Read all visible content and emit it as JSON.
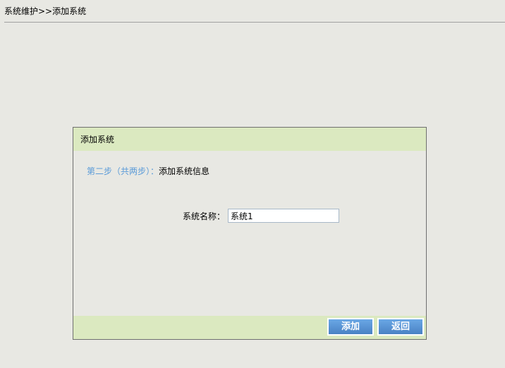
{
  "breadcrumb": "系统维护>>添加系统",
  "dialog": {
    "title": "添加系统",
    "step_label": "第二步（共两步）：",
    "step_text": "添加系统信息",
    "field_label": "系统名称：",
    "field_value": "系统1",
    "add_label": "添加",
    "back_label": "返回"
  }
}
